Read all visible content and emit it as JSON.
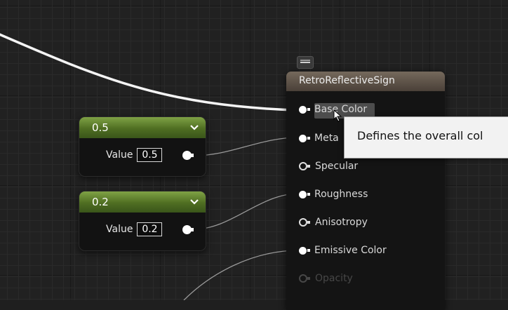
{
  "constant_nodes": [
    {
      "header": "0.5",
      "value_label": "Value",
      "value": "0.5",
      "chevron_icon": "chevron-down-icon"
    },
    {
      "header": "0.2",
      "value_label": "Value",
      "value": "0.2",
      "chevron_icon": "chevron-down-icon"
    }
  ],
  "material_node": {
    "title": "RetroReflectiveSign",
    "pins": [
      {
        "label": "Base Color",
        "connected": true,
        "highlighted": true
      },
      {
        "label": "Meta",
        "connected": true
      },
      {
        "label": "Specular",
        "connected": false
      },
      {
        "label": "Roughness",
        "connected": true
      },
      {
        "label": "Anisotropy",
        "connected": false
      },
      {
        "label": "Emissive Color",
        "connected": true
      },
      {
        "label": "Opacity",
        "connected": false,
        "disabled": true
      }
    ]
  },
  "tooltip": {
    "text": "Defines the overall col"
  },
  "colors": {
    "constant_header": "#5a7a2a",
    "material_header": "#5e544a",
    "canvas": "#212121",
    "wire": "#ffffff"
  }
}
